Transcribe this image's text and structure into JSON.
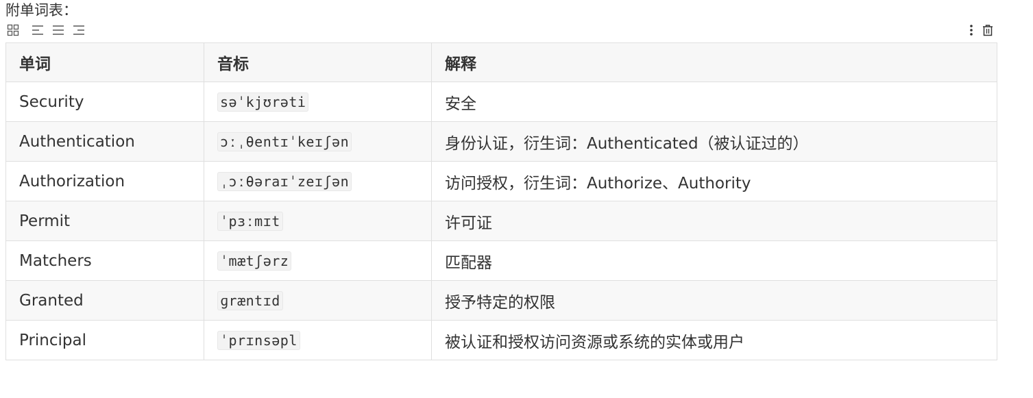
{
  "caption": "附单词表：",
  "toolbar": {
    "left_icons": [
      "grid-icon",
      "align-left-icon",
      "align-center-icon",
      "align-right-icon"
    ],
    "right_icons": [
      "more-vertical-icon",
      "trash-icon"
    ]
  },
  "table": {
    "headers": [
      "单词",
      "音标",
      "解释"
    ],
    "rows": [
      {
        "word": "Security",
        "phonetic": "səˈkjʊrəti",
        "meaning": "安全"
      },
      {
        "word": "Authentication",
        "phonetic": "ɔːˌθentɪˈkeɪʃən",
        "meaning": "身份认证，衍生词：Authenticated（被认证过的）"
      },
      {
        "word": "Authorization",
        "phonetic": "ˌɔːθəraɪˈzeɪʃən",
        "meaning": "访问授权，衍生词：Authorize、Authority"
      },
      {
        "word": "Permit",
        "phonetic": "ˈpɜːmɪt",
        "meaning": "许可证"
      },
      {
        "word": "Matchers",
        "phonetic": "ˈmætʃərz",
        "meaning": "匹配器"
      },
      {
        "word": "Granted",
        "phonetic": "ɡræntɪd",
        "meaning": "授予特定的权限"
      },
      {
        "word": "Principal",
        "phonetic": "ˈprɪnsəpl",
        "meaning": "被认证和授权访问资源或系统的实体或用户"
      }
    ]
  }
}
